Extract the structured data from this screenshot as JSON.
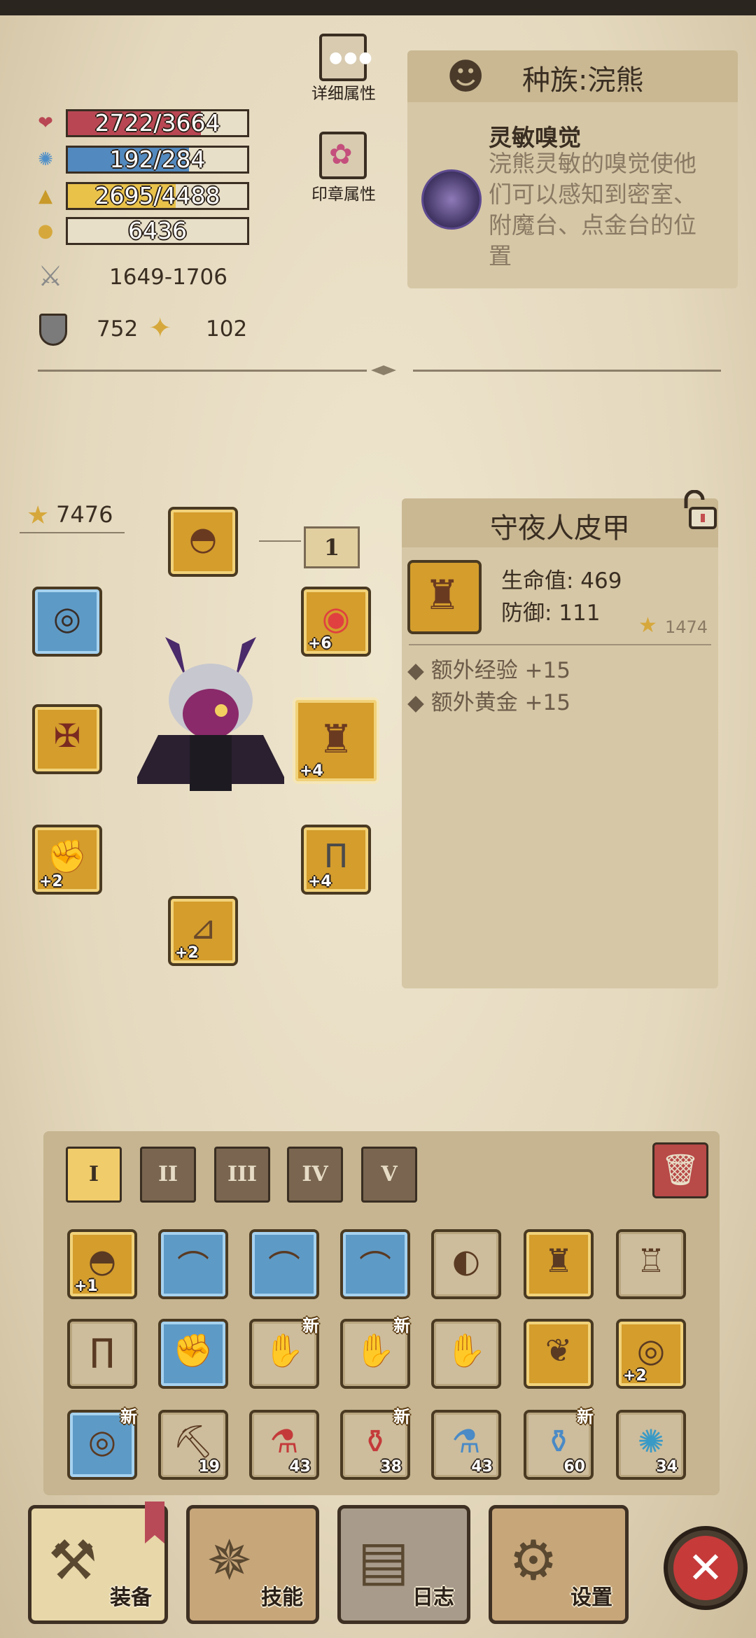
{
  "stats": {
    "hp": "2722/3664",
    "hp_fraction": 0.743,
    "mp": "192/284",
    "mp_fraction": 0.676,
    "exp": "2695/4488",
    "exp_fraction": 0.6,
    "gold": "6436",
    "attack": "1649-1706",
    "defense": "752",
    "luck": "102",
    "colors": {
      "hp": "#b94753",
      "mp": "#5289be",
      "exp": "#e9c24a"
    }
  },
  "buttons": {
    "detail_attrs": "详细属性",
    "seal_attrs": "印章属性"
  },
  "race": {
    "title": "种族:浣熊",
    "skill_name": "灵敏嗅觉",
    "skill_desc": "浣熊灵敏的嗅觉使他们可以感知到密室、附魔台、点金台的位置"
  },
  "equipment": {
    "total_score": "7476",
    "page_label": "1",
    "slots": {
      "ring_left": "",
      "ring_right": "+6",
      "armor": "+4",
      "glove": "+2",
      "pants": "+4",
      "boots": "+2"
    }
  },
  "item_detail": {
    "name": "守夜人皮甲",
    "hp_label": "生命值: 469",
    "def_label": "防御: 111",
    "score": "1474",
    "extras": [
      "额外经验 +15",
      "额外黄金 +15"
    ]
  },
  "bag": {
    "tabs": [
      "I",
      "II",
      "III",
      "IV",
      "V"
    ],
    "active_tab": 0,
    "row1": [
      {
        "icon": "helmet",
        "lvl": "+1",
        "border": "gold"
      },
      {
        "icon": "hat",
        "lvl": "",
        "border": "blue"
      },
      {
        "icon": "hat",
        "lvl": "",
        "border": "blue"
      },
      {
        "icon": "hat",
        "lvl": "",
        "border": "blue"
      },
      {
        "icon": "iron-helmet",
        "lvl": "",
        "border": "plain"
      },
      {
        "icon": "leather-armor",
        "lvl": "",
        "border": "gold"
      },
      {
        "icon": "plate-armor",
        "lvl": "",
        "border": "plain"
      }
    ],
    "row2": [
      {
        "icon": "greaves",
        "badge": "",
        "lvl": ""
      },
      {
        "icon": "gauntlet",
        "badge": "",
        "lvl": ""
      },
      {
        "icon": "claw-glove",
        "badge": "新",
        "lvl": ""
      },
      {
        "icon": "claw-glove",
        "badge": "新",
        "lvl": ""
      },
      {
        "icon": "claw-glove",
        "badge": "",
        "lvl": ""
      },
      {
        "icon": "amulet",
        "badge": "",
        "lvl": ""
      },
      {
        "icon": "ring",
        "badge": "",
        "lvl": "+2"
      }
    ],
    "row3": [
      {
        "icon": "ring",
        "badge": "新",
        "count": ""
      },
      {
        "icon": "pickaxe",
        "badge": "",
        "count": "19"
      },
      {
        "icon": "red-potion-small",
        "badge": "",
        "count": "43"
      },
      {
        "icon": "red-potion-large",
        "badge": "新",
        "count": "38"
      },
      {
        "icon": "blue-potion-small",
        "badge": "",
        "count": "43"
      },
      {
        "icon": "blue-potion-large",
        "badge": "新",
        "count": "60"
      },
      {
        "icon": "map-scroll",
        "badge": "",
        "count": "34"
      }
    ]
  },
  "nav": {
    "equip": "装备",
    "skill": "技能",
    "log": "日志",
    "settings": "设置"
  }
}
